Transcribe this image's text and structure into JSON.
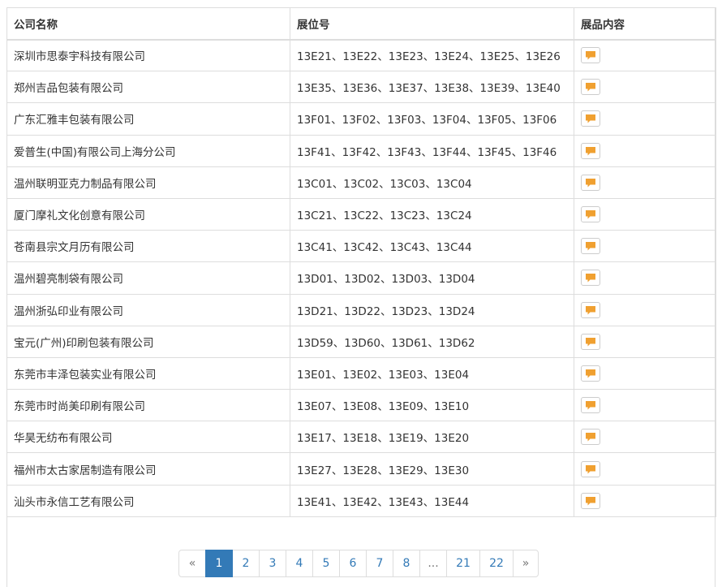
{
  "table": {
    "headers": {
      "company": "公司名称",
      "booth": "展位号",
      "products": "展品内容"
    },
    "rows": [
      {
        "company": "深圳市思泰宇科技有限公司",
        "booth": "13E21、13E22、13E23、13E24、13E25、13E26"
      },
      {
        "company": "郑州吉品包装有限公司",
        "booth": "13E35、13E36、13E37、13E38、13E39、13E40"
      },
      {
        "company": "广东汇雅丰包装有限公司",
        "booth": "13F01、13F02、13F03、13F04、13F05、13F06"
      },
      {
        "company": "爱普生(中国)有限公司上海分公司",
        "booth": "13F41、13F42、13F43、13F44、13F45、13F46"
      },
      {
        "company": "温州联明亚克力制品有限公司",
        "booth": "13C01、13C02、13C03、13C04"
      },
      {
        "company": "厦门摩礼文化创意有限公司",
        "booth": "13C21、13C22、13C23、13C24"
      },
      {
        "company": "苍南县宗文月历有限公司",
        "booth": "13C41、13C42、13C43、13C44"
      },
      {
        "company": "温州碧亮制袋有限公司",
        "booth": "13D01、13D02、13D03、13D04"
      },
      {
        "company": "温州浙弘印业有限公司",
        "booth": "13D21、13D22、13D23、13D24"
      },
      {
        "company": "宝元(广州)印刷包装有限公司",
        "booth": "13D59、13D60、13D61、13D62"
      },
      {
        "company": "东莞市丰泽包装实业有限公司",
        "booth": "13E01、13E02、13E03、13E04"
      },
      {
        "company": "东莞市时尚美印刷有限公司",
        "booth": "13E07、13E08、13E09、13E10"
      },
      {
        "company": "华昊无纺布有限公司",
        "booth": "13E17、13E18、13E19、13E20"
      },
      {
        "company": "福州市太古家居制造有限公司",
        "booth": "13E27、13E28、13E29、13E30"
      },
      {
        "company": "汕头市永信工艺有限公司",
        "booth": "13E41、13E42、13E43、13E44"
      }
    ],
    "products_icon": "comment-icon"
  },
  "pagination": {
    "items": [
      {
        "label": "«",
        "kind": "prev"
      },
      {
        "label": "1",
        "kind": "page",
        "active": true
      },
      {
        "label": "2",
        "kind": "page"
      },
      {
        "label": "3",
        "kind": "page"
      },
      {
        "label": "4",
        "kind": "page"
      },
      {
        "label": "5",
        "kind": "page"
      },
      {
        "label": "6",
        "kind": "page"
      },
      {
        "label": "7",
        "kind": "page"
      },
      {
        "label": "8",
        "kind": "page"
      },
      {
        "label": "...",
        "kind": "ellipsis"
      },
      {
        "label": "21",
        "kind": "page"
      },
      {
        "label": "22",
        "kind": "page"
      },
      {
        "label": "»",
        "kind": "next"
      }
    ]
  },
  "colors": {
    "accent": "#337ab7",
    "icon": "#f0a030",
    "border": "#dddddd"
  }
}
